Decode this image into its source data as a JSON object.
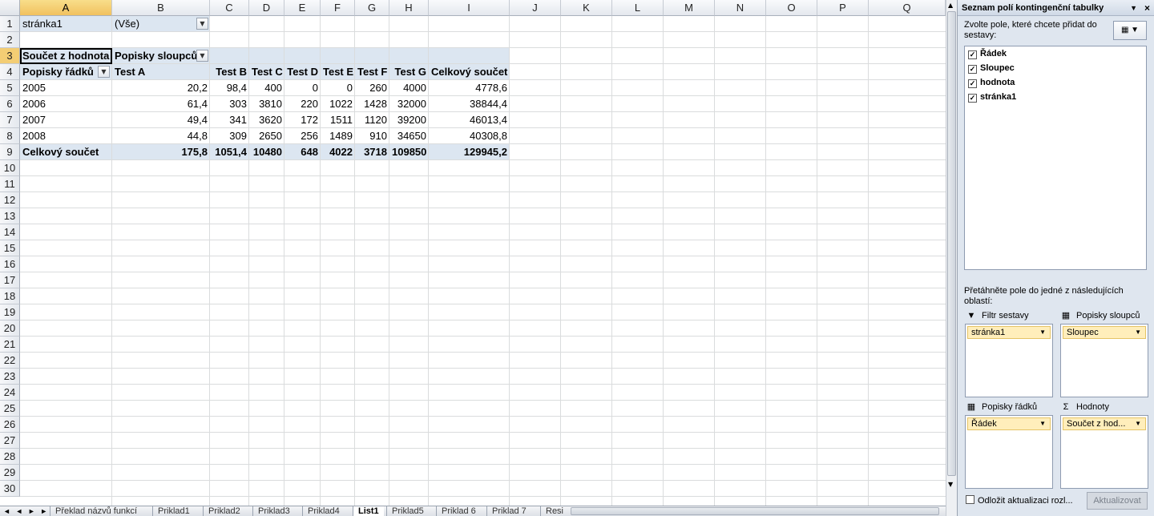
{
  "columns": [
    "A",
    "B",
    "C",
    "D",
    "E",
    "F",
    "G",
    "H",
    "I",
    "J",
    "K",
    "L",
    "M",
    "N",
    "O",
    "P",
    "Q"
  ],
  "rows": [
    "1",
    "2",
    "3",
    "4",
    "5",
    "6",
    "7",
    "8",
    "9",
    "10",
    "11",
    "12",
    "13",
    "14",
    "15",
    "16",
    "17",
    "18",
    "19",
    "20",
    "21",
    "22",
    "23",
    "24",
    "25",
    "26",
    "27",
    "28",
    "29",
    "30"
  ],
  "pivot": {
    "filter_label": "stránka1",
    "filter_value": "(Vše)",
    "value_header": "Součet z hodnota",
    "col_labels_header": "Popisky sloupců",
    "row_labels_header": "Popisky řádků",
    "col_names": [
      "Test A",
      "Test B",
      "Test C",
      "Test D",
      "Test E",
      "Test F",
      "Test G",
      "Celkový součet"
    ],
    "data_rows": [
      {
        "label": "2005",
        "values": [
          "20,2",
          "98,4",
          "400",
          "0",
          "0",
          "260",
          "4000",
          "4778,6"
        ]
      },
      {
        "label": "2006",
        "values": [
          "61,4",
          "303",
          "3810",
          "220",
          "1022",
          "1428",
          "32000",
          "38844,4"
        ]
      },
      {
        "label": "2007",
        "values": [
          "49,4",
          "341",
          "3620",
          "172",
          "1511",
          "1120",
          "39200",
          "46013,4"
        ]
      },
      {
        "label": "2008",
        "values": [
          "44,8",
          "309",
          "2650",
          "256",
          "1489",
          "910",
          "34650",
          "40308,8"
        ]
      }
    ],
    "total_label": "Celkový součet",
    "total_values": [
      "175,8",
      "1051,4",
      "10480",
      "648",
      "4022",
      "3718",
      "109850",
      "129945,2"
    ]
  },
  "sheet_tabs": [
    "Překlad názvů funkcí",
    "Priklad1",
    "Priklad2",
    "Priklad3",
    "Priklad4",
    "List1",
    "Priklad5",
    "Priklad 6",
    "Priklad 7",
    "Resi"
  ],
  "active_tab": "List1",
  "panel": {
    "title": "Seznam polí kontingenční tabulky",
    "choose_text": "Zvolte pole, které chcete přidat do sestavy:",
    "fields": [
      "Řádek",
      "Sloupec",
      "hodnota",
      "stránka1"
    ],
    "drag_text": "Přetáhněte pole do jedné z následujících oblastí:",
    "area_filter": "Filtr sestavy",
    "area_columns": "Popisky sloupců",
    "area_rows": "Popisky řádků",
    "area_values": "Hodnoty",
    "chip_filter": "stránka1",
    "chip_columns": "Sloupec",
    "chip_rows": "Řádek",
    "chip_values": "Součet z hod...",
    "defer_label": "Odložit aktualizaci rozl...",
    "update_button": "Aktualizovat"
  }
}
